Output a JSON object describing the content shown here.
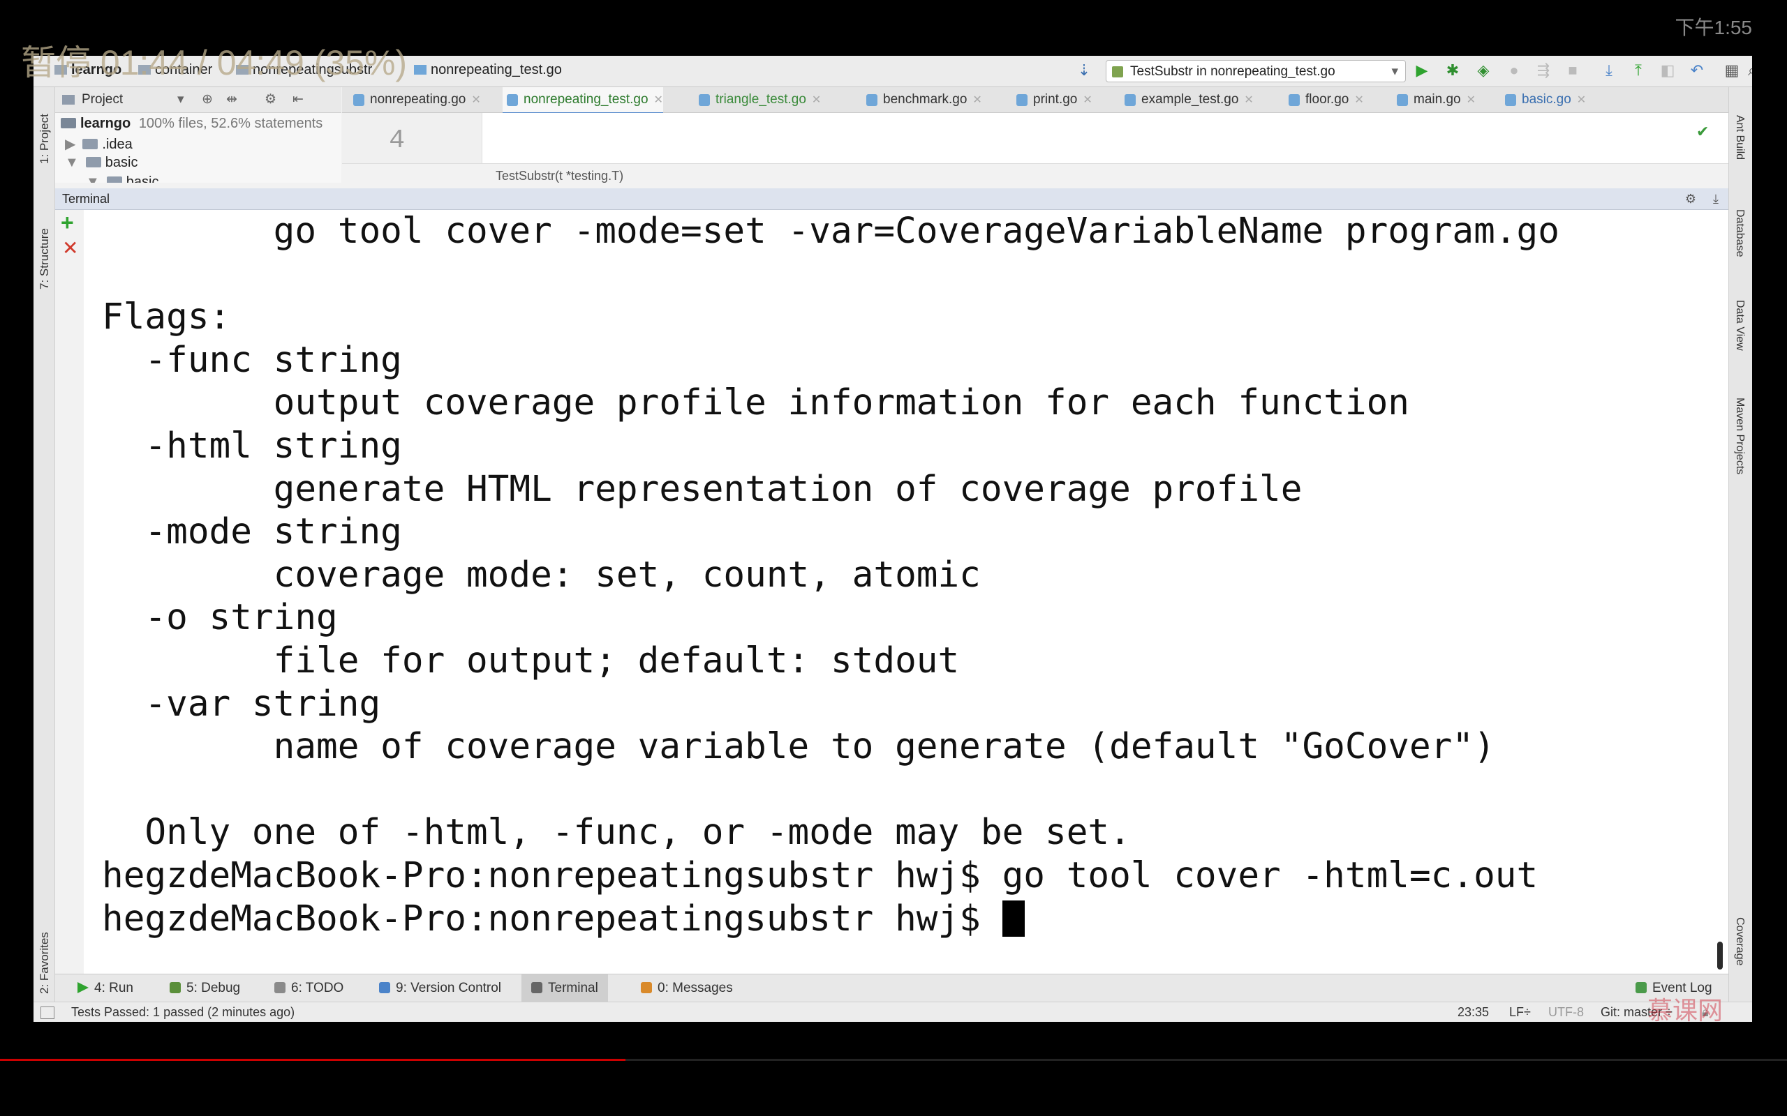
{
  "overlay": {
    "video_status": "暂停 01:44 / 04:49 (35%)",
    "clock": "下午1:55",
    "progress": 0.35,
    "watermark": "慕课网"
  },
  "navbar": {
    "breadcrumbs": [
      "learngo",
      "container",
      "nonrepeatingsubstr",
      "nonrepeating_test.go"
    ],
    "run_config": "TestSubstr in nonrepeating_test.go"
  },
  "left_stripe": {
    "project": "1: Project",
    "structure": "7: Structure",
    "favorites": "2: Favorites"
  },
  "right_stripe": {
    "ant": "Ant Build",
    "database": "Database",
    "dataview": "Data View",
    "maven": "Maven Projects",
    "coverage": "Coverage"
  },
  "project_panel": {
    "title": "Project",
    "root": "learngo",
    "root_info": "100% files, 52.6% statements",
    "items": [
      ".idea",
      "basic",
      "basic"
    ]
  },
  "tabs": [
    {
      "label": "nonrepeating.go",
      "active": false
    },
    {
      "label": "nonrepeating_test.go",
      "active": true
    },
    {
      "label": "triangle_test.go",
      "active": false
    },
    {
      "label": "benchmark.go",
      "active": false
    },
    {
      "label": "print.go",
      "active": false
    },
    {
      "label": "example_test.go",
      "active": false
    },
    {
      "label": "floor.go",
      "active": false
    },
    {
      "label": "main.go",
      "active": false
    },
    {
      "label": "basic.go",
      "active": false
    }
  ],
  "editor": {
    "line_number": "4",
    "breadcrumb": "TestSubstr(t *testing.T)"
  },
  "terminal": {
    "title": "Terminal",
    "lines": [
      "        go tool cover -mode=set -var=CoverageVariableName program.go",
      "",
      "Flags:",
      "  -func string",
      "        output coverage profile information for each function",
      "  -html string",
      "        generate HTML representation of coverage profile",
      "  -mode string",
      "        coverage mode: set, count, atomic",
      "  -o string",
      "        file for output; default: stdout",
      "  -var string",
      "        name of coverage variable to generate (default \"GoCover\")",
      "",
      "  Only one of -html, -func, or -mode may be set.",
      "hegzdeMacBook-Pro:nonrepeatingsubstr hwj$ go tool cover -html=c.out"
    ],
    "prompt": "hegzdeMacBook-Pro:nonrepeatingsubstr hwj$ "
  },
  "tool_windows": [
    {
      "label": "4: Run"
    },
    {
      "label": "5: Debug"
    },
    {
      "label": "6: TODO"
    },
    {
      "label": "9: Version Control"
    },
    {
      "label": "Terminal"
    },
    {
      "label": "0: Messages"
    }
  ],
  "event_log": "Event Log",
  "status_bar": {
    "message": "Tests Passed: 1 passed (2 minutes ago)",
    "position": "23:35",
    "line_sep": "LF÷",
    "encoding": "UTF-8",
    "vcs": "Git: master ÷"
  },
  "colors": {
    "accent": "#4b83c9",
    "progress": "#cc0000",
    "run_green": "#2fa32f"
  }
}
